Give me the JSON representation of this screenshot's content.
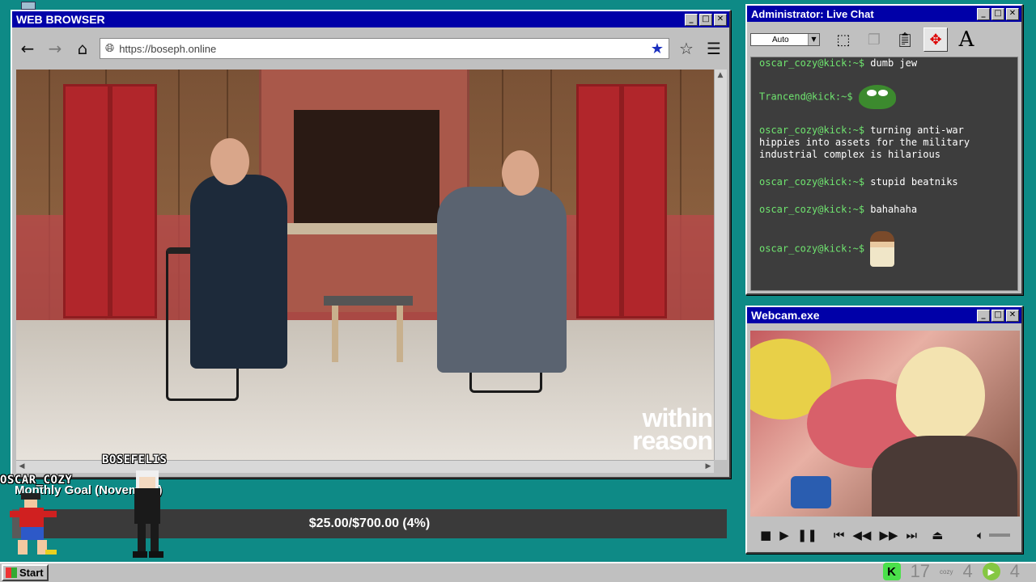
{
  "browser": {
    "title": "WEB BROWSER",
    "url": "https://boseph.online",
    "video_watermark_line1": "within",
    "video_watermark_line2": "reason"
  },
  "chat": {
    "title": "Administrator: Live Chat",
    "auto_select": "Auto",
    "messages": [
      {
        "user": "oscar_cozy@kick:~$",
        "text": "dumb jew",
        "emote": ""
      },
      {
        "user": "Trancend@kick:~$",
        "text": "",
        "emote": "pepe-emote"
      },
      {
        "user": "oscar_cozy@kick:~$",
        "text": "turning anti-war hippies into assets for the military industrial complex is hilarious",
        "emote": ""
      },
      {
        "user": "oscar_cozy@kick:~$",
        "text": "stupid beatniks",
        "emote": ""
      },
      {
        "user": "oscar_cozy@kick:~$",
        "text": "bahahaha",
        "emote": ""
      },
      {
        "user": "oscar_cozy@kick:~$",
        "text": "",
        "emote": "jesus-emote"
      }
    ]
  },
  "webcam": {
    "title": "Webcam.exe"
  },
  "goal": {
    "title": "Monthly Goal (November)",
    "progress_text": "$25.00/$700.00 (4%)",
    "progress_fraction": 0.04
  },
  "sprites": {
    "name1": "OSCAR_COZY",
    "name2": "BOSEFELIS"
  },
  "taskbar": {
    "start_label": "Start",
    "kick_count": "17",
    "kick_small": "cozy",
    "rumble_count1": "4",
    "rumble_count2": "4"
  },
  "colors": {
    "desktop": "#0e8a86",
    "titlebar": "#0000a8",
    "chat_user": "#6fe46f",
    "chat_bg": "#3d3d3d"
  }
}
